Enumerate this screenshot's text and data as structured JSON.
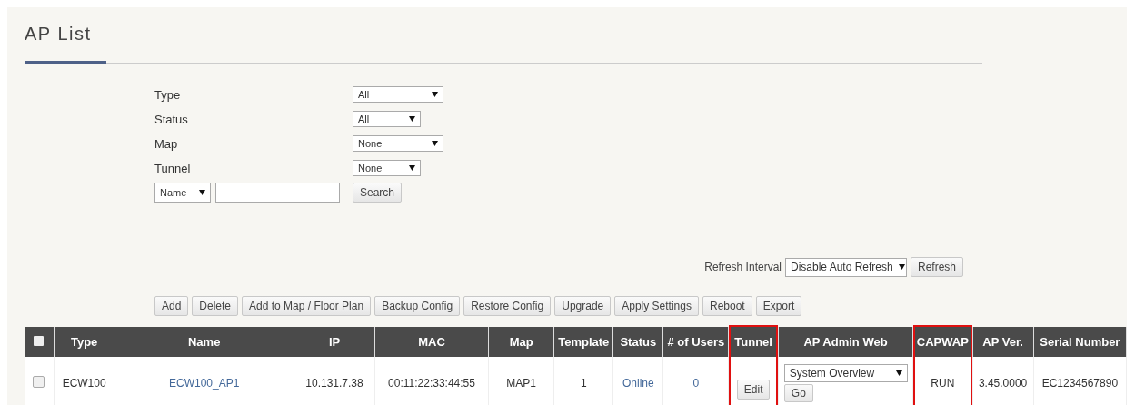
{
  "title": "AP List",
  "filters": [
    {
      "label": "Type",
      "value": "All",
      "kind": "wide"
    },
    {
      "label": "Status",
      "value": "All",
      "kind": "narrow"
    },
    {
      "label": "Map",
      "value": "None",
      "kind": "wide"
    },
    {
      "label": "Tunnel",
      "value": "None",
      "kind": "narrow"
    }
  ],
  "search": {
    "field": "Name",
    "button": "Search"
  },
  "refresh": {
    "label": "Refresh Interval",
    "value": "Disable Auto Refresh",
    "button": "Refresh"
  },
  "actions": [
    "Add",
    "Delete",
    "Add to Map / Floor Plan",
    "Backup Config",
    "Restore Config",
    "Upgrade",
    "Apply Settings",
    "Reboot",
    "Export"
  ],
  "table": {
    "select_all": {
      "checked": false
    },
    "columns": [
      {
        "label": "Type",
        "highlighted": false
      },
      {
        "label": "Name",
        "highlighted": false
      },
      {
        "label": "IP",
        "highlighted": false
      },
      {
        "label": "MAC",
        "highlighted": false
      },
      {
        "label": "Map",
        "highlighted": false
      },
      {
        "label": "Template",
        "highlighted": false
      },
      {
        "label": "Status",
        "highlighted": false
      },
      {
        "label": "# of Users",
        "highlighted": false
      },
      {
        "label": "Tunnel",
        "highlighted": true
      },
      {
        "label": "AP Admin Web",
        "highlighted": false
      },
      {
        "label": "CAPWAP",
        "highlighted": true
      },
      {
        "label": "AP Ver.",
        "highlighted": false
      },
      {
        "label": "Serial Number",
        "highlighted": false
      }
    ],
    "rows": [
      {
        "checked": false,
        "cells": [
          {
            "kind": "text",
            "text": "ECW100"
          },
          {
            "kind": "link",
            "text": "ECW100_AP1"
          },
          {
            "kind": "text",
            "text": "10.131.7.38"
          },
          {
            "kind": "text",
            "text": "00:11:22:33:44:55"
          },
          {
            "kind": "text",
            "text": "MAP1"
          },
          {
            "kind": "text",
            "text": "1"
          },
          {
            "kind": "link",
            "text": "Online"
          },
          {
            "kind": "link",
            "text": "0"
          },
          {
            "kind": "button",
            "text": "Edit"
          },
          {
            "kind": "select",
            "text": "System Overview",
            "button": "Go"
          },
          {
            "kind": "text",
            "text": "RUN"
          },
          {
            "kind": "text",
            "text": "3.45.0000"
          },
          {
            "kind": "text",
            "text": "EC1234567890"
          }
        ]
      }
    ]
  }
}
